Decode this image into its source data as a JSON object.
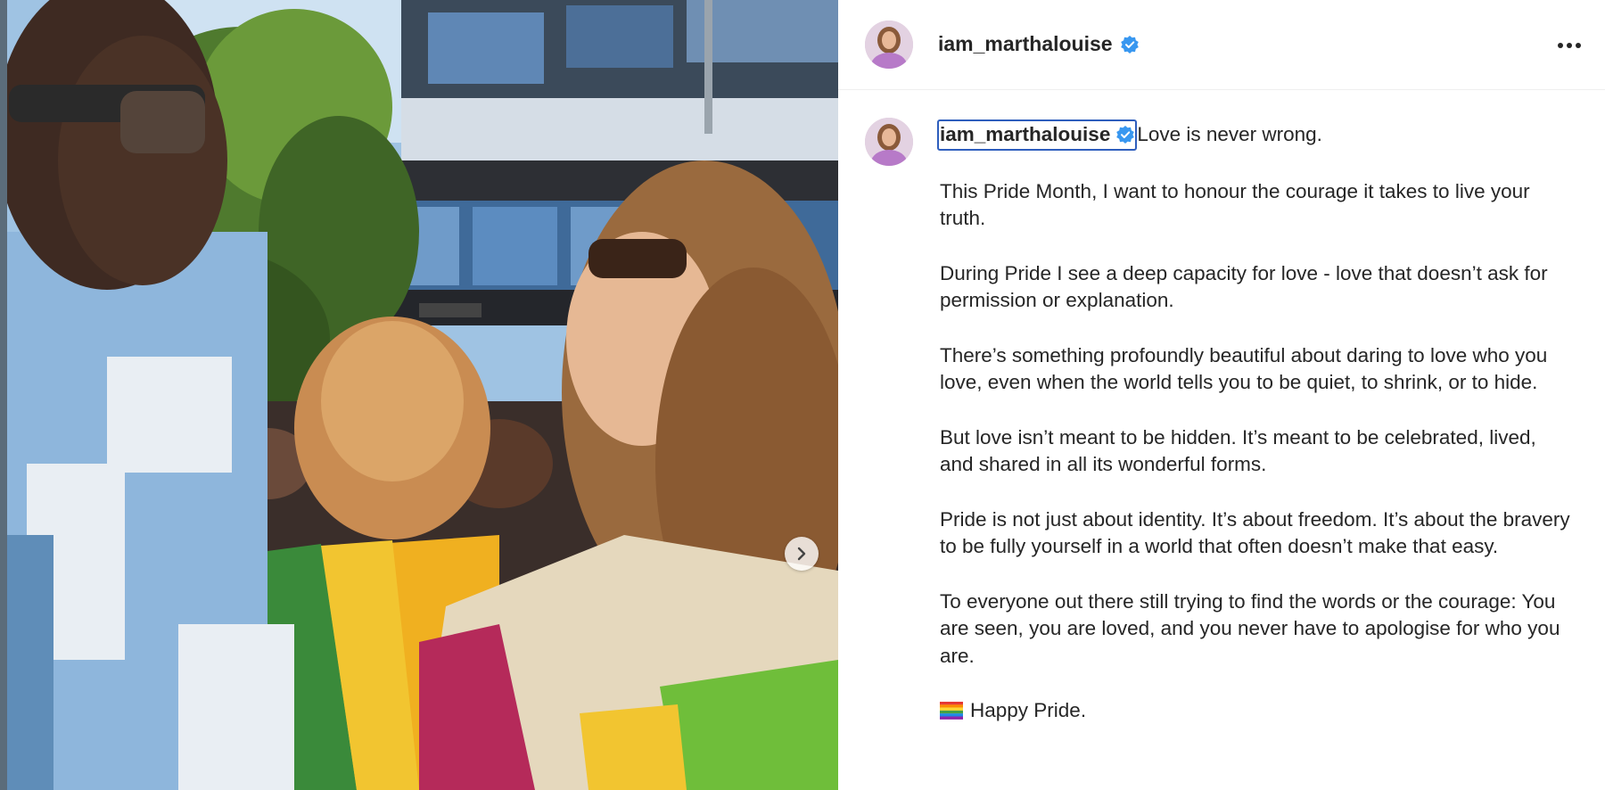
{
  "post": {
    "username": "iam_marthalouise",
    "more_icon": "more-horizontal-icon",
    "verified_icon": "verified-badge-icon",
    "next_icon": "chevron-right-icon"
  },
  "caption": {
    "username": "iam_marthalouise",
    "first_line": "Love is never wrong.",
    "paragraphs": [
      "This Pride Month, I want to honour the courage it takes to live your truth.",
      "During Pride I see a deep capacity for love - love that doesn’t ask for permission or explanation.",
      "There’s something profoundly beautiful about daring to love who you love, even when the world tells you to be quiet, to shrink, or to hide.",
      "But love isn’t meant to be hidden. It’s meant to be celebrated, lived, and shared in all its wonderful forms.",
      "Pride is not just about identity. It’s about freedom. It’s about the bravery to be fully yourself in a world that often doesn’t make that easy.",
      "To everyone out there still trying to find the words or the courage: You are seen, you are loved, and you never have to apologise for who you are."
    ],
    "closing": "Happy Pride.",
    "closing_icon": "rainbow-flag-icon"
  },
  "colors": {
    "verified": "#3897f0",
    "text": "#262626",
    "focus_outline": "#2e5ebd"
  }
}
